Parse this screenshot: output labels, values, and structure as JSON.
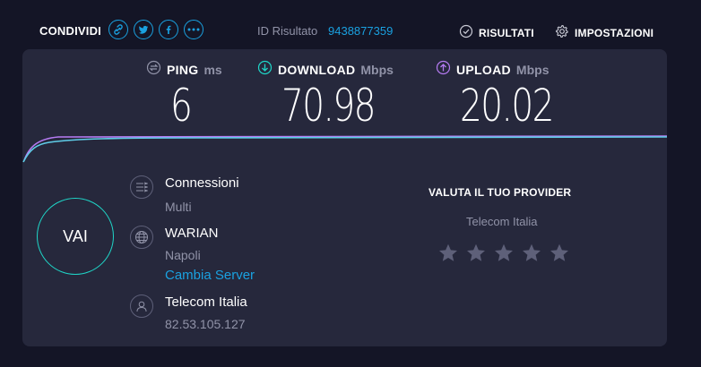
{
  "header": {
    "share_label": "CONDIVIDI",
    "share_icons": [
      "link-icon",
      "twitter-icon",
      "facebook-icon",
      "more-icon"
    ],
    "result_id_label": "ID Risultato",
    "result_id": "9438877359",
    "results_label": "RISULTATI",
    "settings_label": "IMPOSTAZIONI"
  },
  "metrics": {
    "ping": {
      "name": "PING",
      "unit": "ms",
      "value": "6",
      "icon": "ping-icon",
      "color": "#9193a8"
    },
    "download": {
      "name": "DOWNLOAD",
      "unit": "Mbps",
      "value": "70.98",
      "icon": "download-icon",
      "color": "#1fd6c8"
    },
    "upload": {
      "name": "UPLOAD",
      "unit": "Mbps",
      "value": "20.02",
      "icon": "upload-icon",
      "color": "#b57bf2"
    }
  },
  "go_button": {
    "label": "VAI"
  },
  "server_info": {
    "connections": {
      "title": "Connessioni",
      "value": "Multi",
      "icon": "connections-icon"
    },
    "server": {
      "title": "WARIAN",
      "location": "Napoli",
      "change_label": "Cambia Server",
      "icon": "globe-icon"
    },
    "provider": {
      "title": "Telecom Italia",
      "ip": "82.53.105.127",
      "icon": "user-icon"
    }
  },
  "rating": {
    "title": "VALUTA IL TUO PROVIDER",
    "isp": "Telecom Italia",
    "stars": 5,
    "star_color": "#5e6079"
  },
  "colors": {
    "background": "#141526",
    "panel": "#26283c",
    "accent": "#1aa1e0",
    "download_line": "#1fd6c8",
    "upload_line": "#b57bf2"
  }
}
